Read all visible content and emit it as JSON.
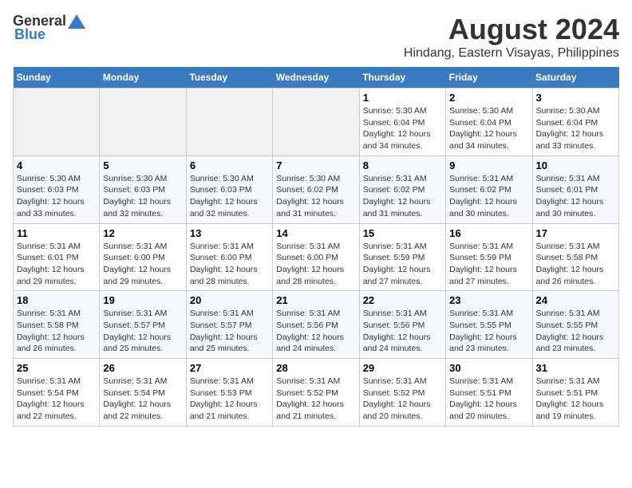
{
  "logo": {
    "general": "General",
    "blue": "Blue"
  },
  "title": "August 2024",
  "subtitle": "Hindang, Eastern Visayas, Philippines",
  "days_of_week": [
    "Sunday",
    "Monday",
    "Tuesday",
    "Wednesday",
    "Thursday",
    "Friday",
    "Saturday"
  ],
  "weeks": [
    [
      {
        "day": "",
        "info": ""
      },
      {
        "day": "",
        "info": ""
      },
      {
        "day": "",
        "info": ""
      },
      {
        "day": "",
        "info": ""
      },
      {
        "day": "1",
        "info": "Sunrise: 5:30 AM\nSunset: 6:04 PM\nDaylight: 12 hours\nand 34 minutes."
      },
      {
        "day": "2",
        "info": "Sunrise: 5:30 AM\nSunset: 6:04 PM\nDaylight: 12 hours\nand 34 minutes."
      },
      {
        "day": "3",
        "info": "Sunrise: 5:30 AM\nSunset: 6:04 PM\nDaylight: 12 hours\nand 33 minutes."
      }
    ],
    [
      {
        "day": "4",
        "info": "Sunrise: 5:30 AM\nSunset: 6:03 PM\nDaylight: 12 hours\nand 33 minutes."
      },
      {
        "day": "5",
        "info": "Sunrise: 5:30 AM\nSunset: 6:03 PM\nDaylight: 12 hours\nand 32 minutes."
      },
      {
        "day": "6",
        "info": "Sunrise: 5:30 AM\nSunset: 6:03 PM\nDaylight: 12 hours\nand 32 minutes."
      },
      {
        "day": "7",
        "info": "Sunrise: 5:30 AM\nSunset: 6:02 PM\nDaylight: 12 hours\nand 31 minutes."
      },
      {
        "day": "8",
        "info": "Sunrise: 5:31 AM\nSunset: 6:02 PM\nDaylight: 12 hours\nand 31 minutes."
      },
      {
        "day": "9",
        "info": "Sunrise: 5:31 AM\nSunset: 6:02 PM\nDaylight: 12 hours\nand 30 minutes."
      },
      {
        "day": "10",
        "info": "Sunrise: 5:31 AM\nSunset: 6:01 PM\nDaylight: 12 hours\nand 30 minutes."
      }
    ],
    [
      {
        "day": "11",
        "info": "Sunrise: 5:31 AM\nSunset: 6:01 PM\nDaylight: 12 hours\nand 29 minutes."
      },
      {
        "day": "12",
        "info": "Sunrise: 5:31 AM\nSunset: 6:00 PM\nDaylight: 12 hours\nand 29 minutes."
      },
      {
        "day": "13",
        "info": "Sunrise: 5:31 AM\nSunset: 6:00 PM\nDaylight: 12 hours\nand 28 minutes."
      },
      {
        "day": "14",
        "info": "Sunrise: 5:31 AM\nSunset: 6:00 PM\nDaylight: 12 hours\nand 28 minutes."
      },
      {
        "day": "15",
        "info": "Sunrise: 5:31 AM\nSunset: 5:59 PM\nDaylight: 12 hours\nand 27 minutes."
      },
      {
        "day": "16",
        "info": "Sunrise: 5:31 AM\nSunset: 5:59 PM\nDaylight: 12 hours\nand 27 minutes."
      },
      {
        "day": "17",
        "info": "Sunrise: 5:31 AM\nSunset: 5:58 PM\nDaylight: 12 hours\nand 26 minutes."
      }
    ],
    [
      {
        "day": "18",
        "info": "Sunrise: 5:31 AM\nSunset: 5:58 PM\nDaylight: 12 hours\nand 26 minutes."
      },
      {
        "day": "19",
        "info": "Sunrise: 5:31 AM\nSunset: 5:57 PM\nDaylight: 12 hours\nand 25 minutes."
      },
      {
        "day": "20",
        "info": "Sunrise: 5:31 AM\nSunset: 5:57 PM\nDaylight: 12 hours\nand 25 minutes."
      },
      {
        "day": "21",
        "info": "Sunrise: 5:31 AM\nSunset: 5:56 PM\nDaylight: 12 hours\nand 24 minutes."
      },
      {
        "day": "22",
        "info": "Sunrise: 5:31 AM\nSunset: 5:56 PM\nDaylight: 12 hours\nand 24 minutes."
      },
      {
        "day": "23",
        "info": "Sunrise: 5:31 AM\nSunset: 5:55 PM\nDaylight: 12 hours\nand 23 minutes."
      },
      {
        "day": "24",
        "info": "Sunrise: 5:31 AM\nSunset: 5:55 PM\nDaylight: 12 hours\nand 23 minutes."
      }
    ],
    [
      {
        "day": "25",
        "info": "Sunrise: 5:31 AM\nSunset: 5:54 PM\nDaylight: 12 hours\nand 22 minutes."
      },
      {
        "day": "26",
        "info": "Sunrise: 5:31 AM\nSunset: 5:54 PM\nDaylight: 12 hours\nand 22 minutes."
      },
      {
        "day": "27",
        "info": "Sunrise: 5:31 AM\nSunset: 5:53 PM\nDaylight: 12 hours\nand 21 minutes."
      },
      {
        "day": "28",
        "info": "Sunrise: 5:31 AM\nSunset: 5:52 PM\nDaylight: 12 hours\nand 21 minutes."
      },
      {
        "day": "29",
        "info": "Sunrise: 5:31 AM\nSunset: 5:52 PM\nDaylight: 12 hours\nand 20 minutes."
      },
      {
        "day": "30",
        "info": "Sunrise: 5:31 AM\nSunset: 5:51 PM\nDaylight: 12 hours\nand 20 minutes."
      },
      {
        "day": "31",
        "info": "Sunrise: 5:31 AM\nSunset: 5:51 PM\nDaylight: 12 hours\nand 19 minutes."
      }
    ]
  ]
}
